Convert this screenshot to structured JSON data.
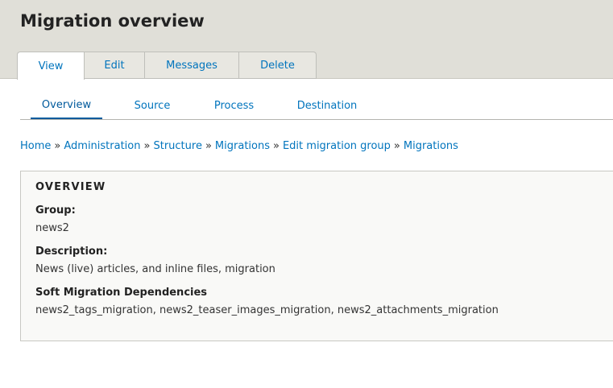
{
  "header": {
    "title": "Migration overview",
    "tabs": [
      {
        "label": "View",
        "active": true
      },
      {
        "label": "Edit",
        "active": false
      },
      {
        "label": "Messages",
        "active": false
      },
      {
        "label": "Delete",
        "active": false
      }
    ]
  },
  "subtabs": [
    {
      "label": "Overview",
      "active": true
    },
    {
      "label": "Source",
      "active": false
    },
    {
      "label": "Process",
      "active": false
    },
    {
      "label": "Destination",
      "active": false
    }
  ],
  "breadcrumb": {
    "items": [
      "Home",
      "Administration",
      "Structure",
      "Migrations",
      "Edit migration group",
      "Migrations"
    ],
    "separator": "»"
  },
  "overview": {
    "heading": "OVERVIEW",
    "group_label": "Group:",
    "group_value": "news2",
    "description_label": "Description:",
    "description_value": "News (live) articles, and inline files, migration",
    "dependencies_label": "Soft Migration Dependencies",
    "dependencies_value": "news2_tags_migration, news2_teaser_images_migration, news2_attachments_migration"
  },
  "colors": {
    "link": "#0074bd",
    "header_bg": "#e0dfd8",
    "panel_bg": "#f9f9f7",
    "active_underline": "#005a9c"
  }
}
